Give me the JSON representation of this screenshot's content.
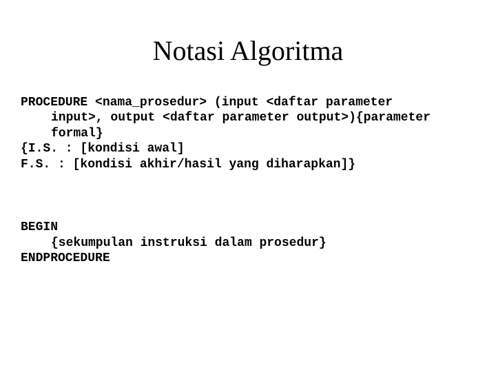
{
  "title": "Notasi Algoritma",
  "block1": {
    "line1a": "PROCEDURE <nama_prosedur> (input <daftar parameter",
    "line1b": "input>, output <daftar parameter output>){parameter",
    "line1c": "formal}",
    "line2": "{I.S. : [kondisi awal]",
    "line3": "F.S. : [kondisi akhir/hasil yang diharapkan]}"
  },
  "block2": {
    "line1": "BEGIN",
    "line2": "{sekumpulan instruksi dalam prosedur}",
    "line3": "ENDPROCEDURE"
  }
}
